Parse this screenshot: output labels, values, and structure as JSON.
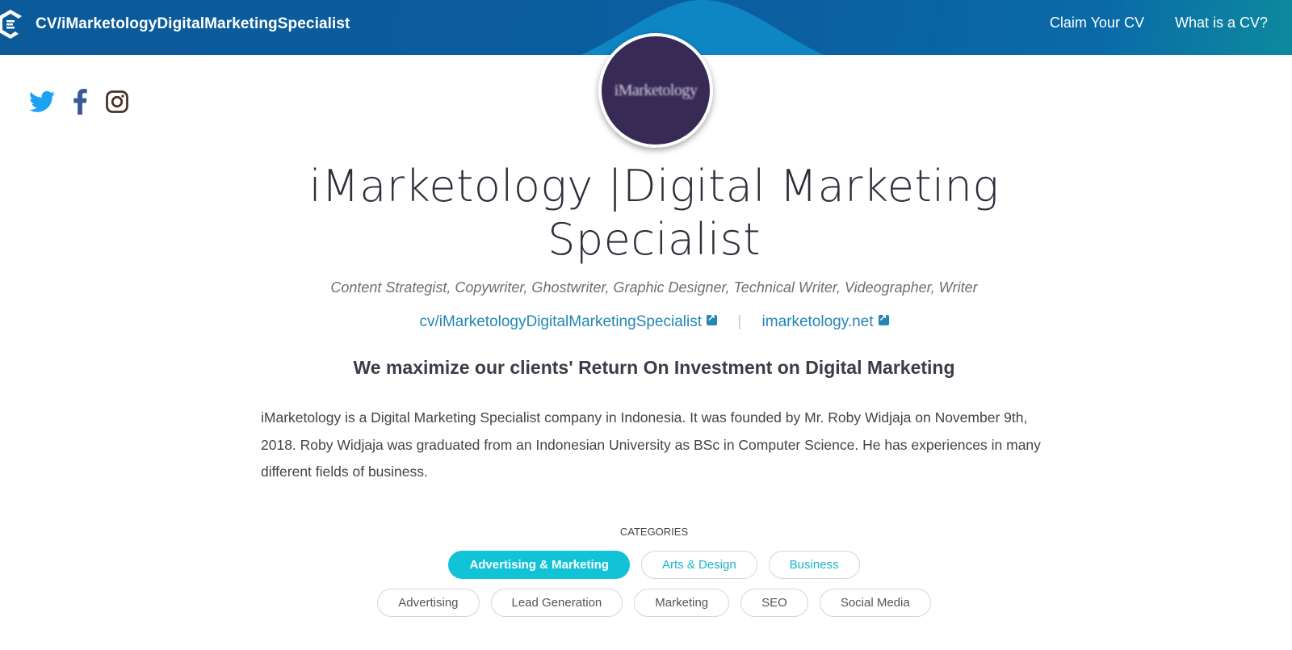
{
  "header": {
    "title": "CV/iMarketologyDigitalMarketingSpecialist",
    "logo_icon": "cv-logo-icon",
    "nav": [
      {
        "label": "Claim Your CV"
      },
      {
        "label": "What is a CV?"
      }
    ]
  },
  "avatar": {
    "text": "iMarketology",
    "background": "#372a55"
  },
  "social": [
    {
      "icon": "twitter-icon",
      "color": "#1da1f2"
    },
    {
      "icon": "facebook-icon",
      "color": "#3b5998"
    },
    {
      "icon": "instagram-icon",
      "color": "#4a3022"
    }
  ],
  "profile": {
    "name": "iMarketology |Digital Marketing Specialist",
    "roles": "Content Strategist, Copywriter, Ghostwriter, Graphic Designer, Technical Writer, Videographer, Writer",
    "links": [
      {
        "label": "cv/iMarketologyDigitalMarketingSpecialist",
        "icon": "external-link-icon"
      },
      {
        "label": "imarketology.net",
        "icon": "external-link-icon"
      }
    ],
    "link_separator": "|",
    "headline": "We maximize our clients' Return On Investment on Digital Marketing",
    "bio": "iMarketology is a Digital Marketing Specialist company in Indonesia. It was founded by Mr. Roby Widjaja on November 9th, 2018. Roby Widjaja was graduated from an Indonesian University as BSc in Computer Science. He has experiences in many different fields of business."
  },
  "categories": {
    "label": "CATEGORIES",
    "primary": [
      {
        "label": "Advertising & Marketing",
        "active": true
      },
      {
        "label": "Arts & Design",
        "active": false
      },
      {
        "label": "Business",
        "active": false
      }
    ],
    "sub": [
      {
        "label": "Advertising"
      },
      {
        "label": "Lead Generation"
      },
      {
        "label": "Marketing"
      },
      {
        "label": "SEO"
      },
      {
        "label": "Social Media"
      }
    ]
  },
  "colors": {
    "header": "#0b5a9a",
    "accent": "#12c3d8",
    "link": "#2386b4"
  }
}
